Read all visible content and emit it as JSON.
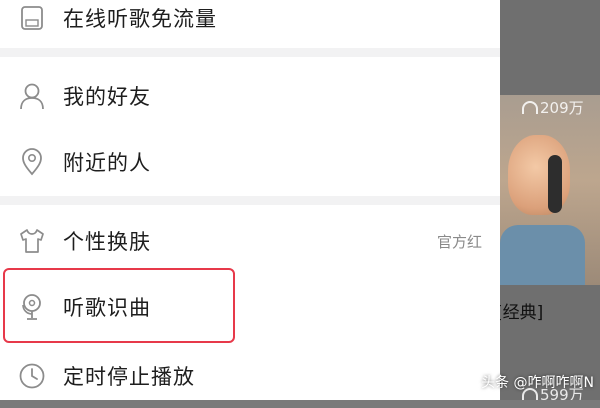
{
  "menu": {
    "items": [
      {
        "label": "在线听歌免流量",
        "icon": "sim-card-icon"
      },
      {
        "label": "我的好友",
        "icon": "person-icon"
      },
      {
        "label": "附近的人",
        "icon": "location-pin-icon"
      },
      {
        "label": "个性换肤",
        "icon": "tshirt-icon",
        "extra": "官方红"
      },
      {
        "label": "听歌识曲",
        "icon": "microphone-icon"
      },
      {
        "label": "定时停止播放",
        "icon": "clock-icon"
      }
    ]
  },
  "background": {
    "play_count_1": "209万",
    "play_count_2": "599万",
    "caption": "[经典]"
  },
  "watermark": "头条 @咋啊咋啊N",
  "colors": {
    "highlight": "#e7394a",
    "separator": "#f2f2f3",
    "overlay": "#6f6f6f"
  }
}
